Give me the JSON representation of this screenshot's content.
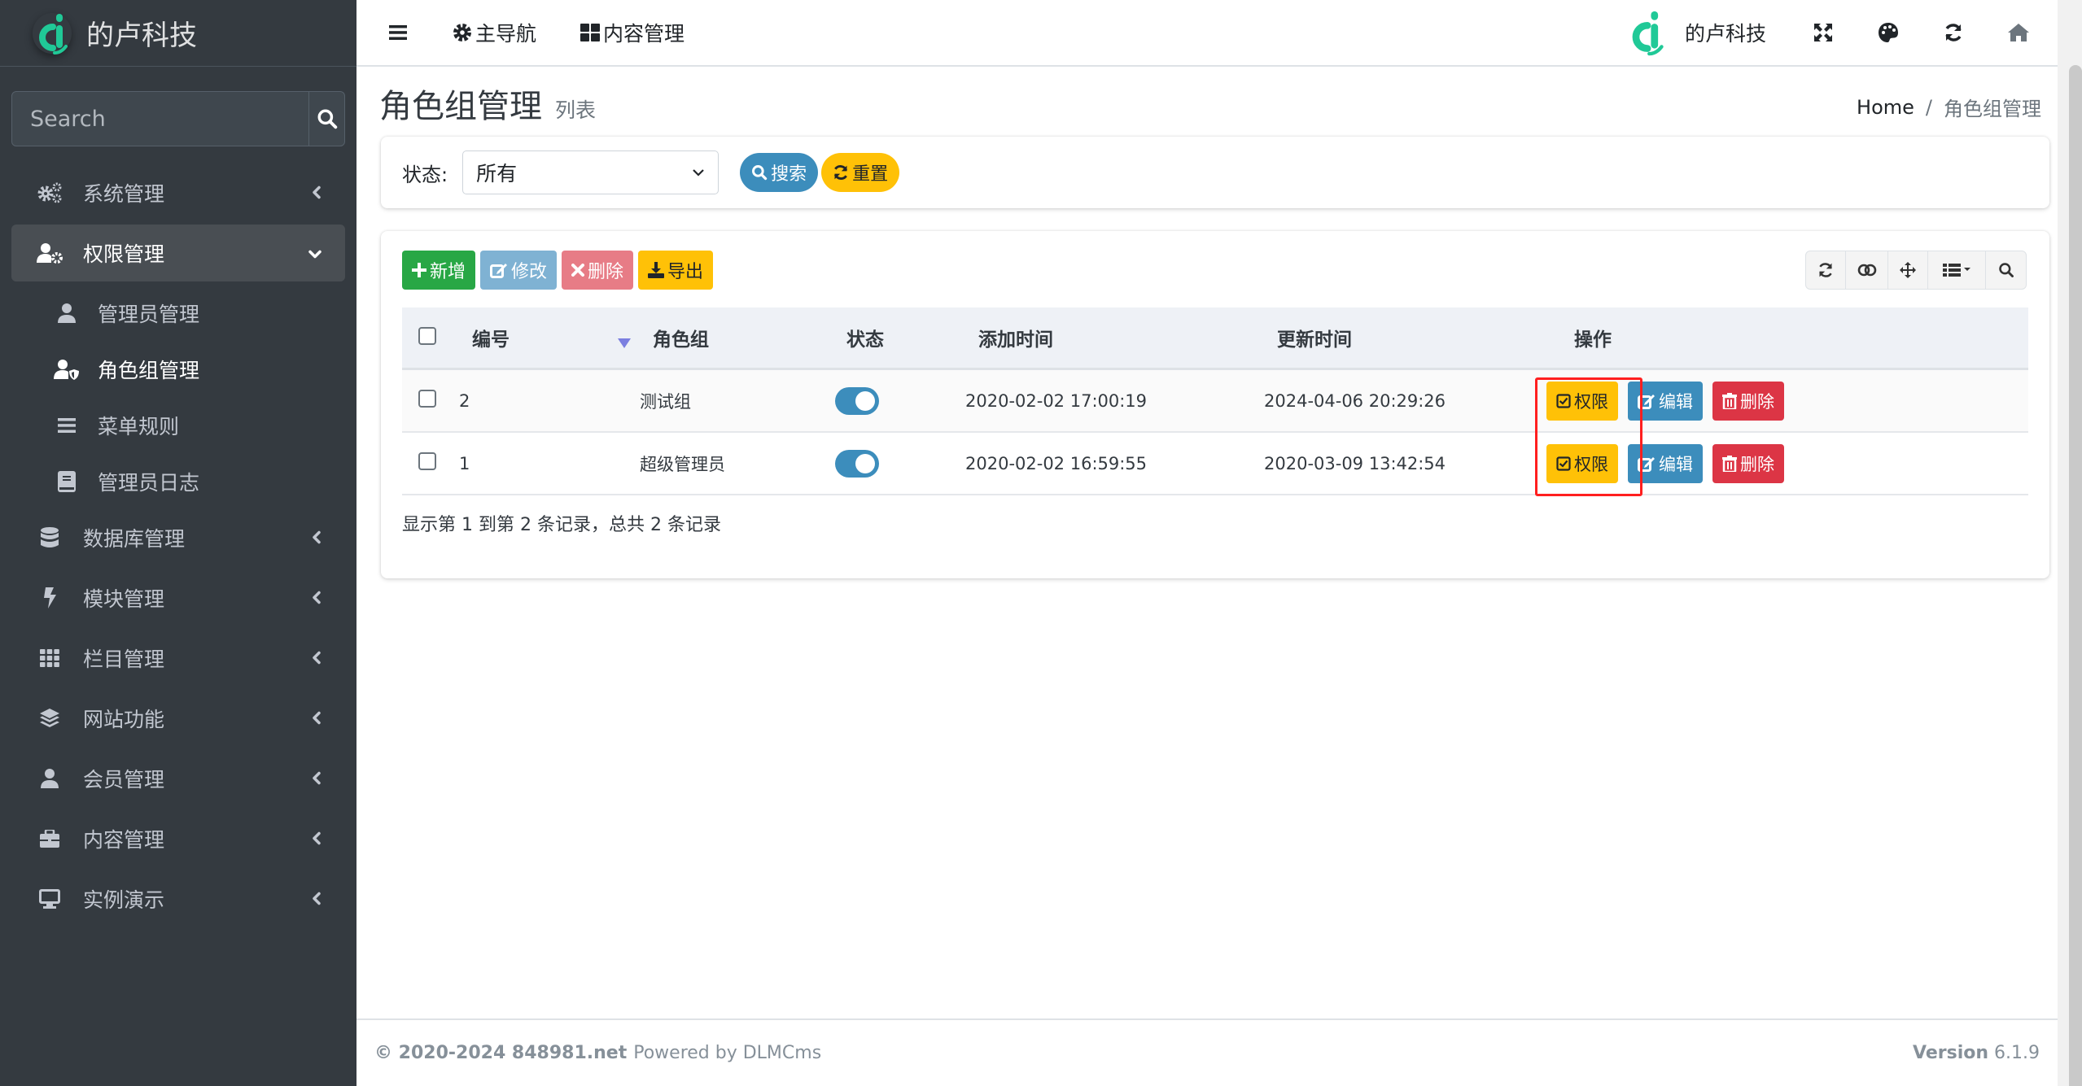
{
  "brand": {
    "name": "的卢科技",
    "logo_color": "#20c997"
  },
  "sidebar": {
    "search_placeholder": "Search",
    "items": [
      {
        "label": "系统管理",
        "icon": "cogs-icon",
        "state": "collapsed"
      },
      {
        "label": "权限管理",
        "icon": "user-cog-icon",
        "state": "open",
        "children": [
          {
            "label": "管理员管理",
            "icon": "user-icon"
          },
          {
            "label": "角色组管理",
            "icon": "user-shield-icon",
            "active": true
          },
          {
            "label": "菜单规则",
            "icon": "bars-icon"
          },
          {
            "label": "管理员日志",
            "icon": "book-icon"
          }
        ]
      },
      {
        "label": "数据库管理",
        "icon": "database-icon",
        "state": "collapsed"
      },
      {
        "label": "模块管理",
        "icon": "bolt-icon",
        "state": "collapsed"
      },
      {
        "label": "栏目管理",
        "icon": "th-icon",
        "state": "collapsed"
      },
      {
        "label": "网站功能",
        "icon": "layers-icon",
        "state": "collapsed"
      },
      {
        "label": "会员管理",
        "icon": "user-icon",
        "state": "collapsed"
      },
      {
        "label": "内容管理",
        "icon": "briefcase-icon",
        "state": "collapsed"
      },
      {
        "label": "实例演示",
        "icon": "desktop-icon",
        "state": "collapsed"
      }
    ]
  },
  "header": {
    "nav": [
      {
        "label": "主导航",
        "icon": "gear-icon"
      },
      {
        "label": "内容管理",
        "icon": "th-large-icon"
      }
    ],
    "brand_name": "的卢科技",
    "icons": [
      "fullscreen-icon",
      "palette-icon",
      "refresh-icon",
      "home-icon"
    ]
  },
  "page": {
    "title": "角色组管理",
    "subtitle": "列表",
    "breadcrumb": [
      "Home",
      "角色组管理"
    ],
    "breadcrumb_sep": "/"
  },
  "filter": {
    "label": "状态:",
    "select_value": "所有",
    "search_label": "搜索",
    "reset_label": "重置"
  },
  "toolbar": {
    "add": "新增",
    "edit": "修改",
    "delete": "删除",
    "export": "导出",
    "tools": [
      "refresh-icon",
      "toggle-view-icon",
      "move-icon",
      "columns-icon",
      "search-icon"
    ]
  },
  "table": {
    "columns": [
      "编号",
      "角色组",
      "状态",
      "添加时间",
      "更新时间",
      "操作"
    ],
    "rows": [
      {
        "id": "2",
        "name": "测试组",
        "status": true,
        "added": "2020-02-02 17:00:19",
        "updated": "2024-04-06 20:29:26"
      },
      {
        "id": "1",
        "name": "超级管理员",
        "status": true,
        "added": "2020-02-02 16:59:55",
        "updated": "2020-03-09 13:42:54"
      }
    ],
    "actions": {
      "permission": "权限",
      "edit": "编辑",
      "delete": "删除"
    },
    "page_info": "显示第 1 到第 2 条记录，总共 2 条记录"
  },
  "footer": {
    "copyright": "© 2020-2024 848981.net",
    "powered": "Powered by DLMCms",
    "version_label": "Version",
    "version": "6.1.9"
  },
  "colors": {
    "sidebar_bg": "#343a40",
    "primary": "#3c8dbc",
    "success": "#28a745",
    "warning": "#ffc107",
    "danger": "#dc3545",
    "highlight": "#ff1f1f"
  }
}
